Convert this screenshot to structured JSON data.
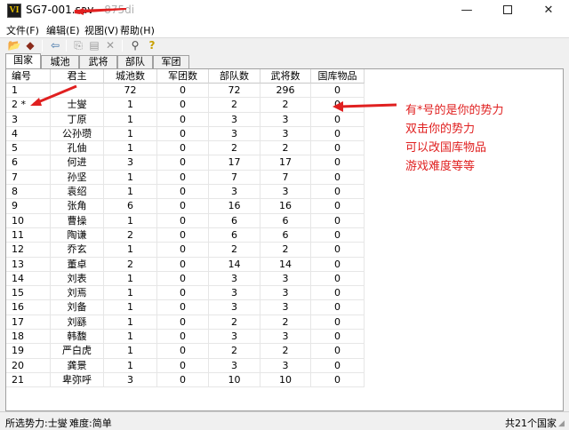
{
  "window": {
    "icon_letter": "VI",
    "title": "SG7-001.sav - ",
    "title_suffix": "875di",
    "minimize": "—",
    "close": "✕"
  },
  "menu": {
    "items": [
      "文件(F)",
      "编辑(E)",
      "视图(V)",
      "帮助(H)"
    ]
  },
  "toolbar": {
    "icons": [
      "open-folder-icon",
      "eraser-icon",
      "back-arrow-icon",
      "copy-icon",
      "paste-icon",
      "delete-icon",
      "find-icon",
      "help-icon"
    ],
    "glyphs": [
      "📂",
      "◆",
      "⇦",
      "⎘",
      "▤",
      "✕",
      "⚲",
      "?"
    ]
  },
  "tabs": [
    "国家",
    "城池",
    "武将",
    "部队",
    "军团"
  ],
  "table": {
    "headers": [
      "编号",
      "君主",
      "城池数",
      "军团数",
      "部队数",
      "武将数",
      "国库物品"
    ],
    "rows": [
      [
        "1",
        "",
        "72",
        "0",
        "72",
        "296",
        "0"
      ],
      [
        "2 *",
        "士燮",
        "1",
        "0",
        "2",
        "2",
        "0"
      ],
      [
        "3",
        "丁原",
        "1",
        "0",
        "3",
        "3",
        "0"
      ],
      [
        "4",
        "公孙瓒",
        "1",
        "0",
        "3",
        "3",
        "0"
      ],
      [
        "5",
        "孔伷",
        "1",
        "0",
        "2",
        "2",
        "0"
      ],
      [
        "6",
        "何进",
        "3",
        "0",
        "17",
        "17",
        "0"
      ],
      [
        "7",
        "孙坚",
        "1",
        "0",
        "7",
        "7",
        "0"
      ],
      [
        "8",
        "袁绍",
        "1",
        "0",
        "3",
        "3",
        "0"
      ],
      [
        "9",
        "张角",
        "6",
        "0",
        "16",
        "16",
        "0"
      ],
      [
        "10",
        "曹操",
        "1",
        "0",
        "6",
        "6",
        "0"
      ],
      [
        "11",
        "陶谦",
        "2",
        "0",
        "6",
        "6",
        "0"
      ],
      [
        "12",
        "乔玄",
        "1",
        "0",
        "2",
        "2",
        "0"
      ],
      [
        "13",
        "董卓",
        "2",
        "0",
        "14",
        "14",
        "0"
      ],
      [
        "14",
        "刘表",
        "1",
        "0",
        "3",
        "3",
        "0"
      ],
      [
        "15",
        "刘焉",
        "1",
        "0",
        "3",
        "3",
        "0"
      ],
      [
        "16",
        "刘备",
        "1",
        "0",
        "3",
        "3",
        "0"
      ],
      [
        "17",
        "刘繇",
        "1",
        "0",
        "2",
        "2",
        "0"
      ],
      [
        "18",
        "韩馥",
        "1",
        "0",
        "3",
        "3",
        "0"
      ],
      [
        "19",
        "严白虎",
        "1",
        "0",
        "2",
        "2",
        "0"
      ],
      [
        "20",
        "龚景",
        "1",
        "0",
        "3",
        "3",
        "0"
      ],
      [
        "21",
        "卑弥呼",
        "3",
        "0",
        "10",
        "10",
        "0"
      ]
    ]
  },
  "annotation": {
    "lines": [
      "有*号的是你的势力",
      "双击你的势力",
      "可以改国库物品",
      "游戏难度等等"
    ],
    "color": "#e02020"
  },
  "status": {
    "selected": "所选势力:士燮",
    "difficulty": "难度:简单",
    "count": "共21个国家"
  }
}
